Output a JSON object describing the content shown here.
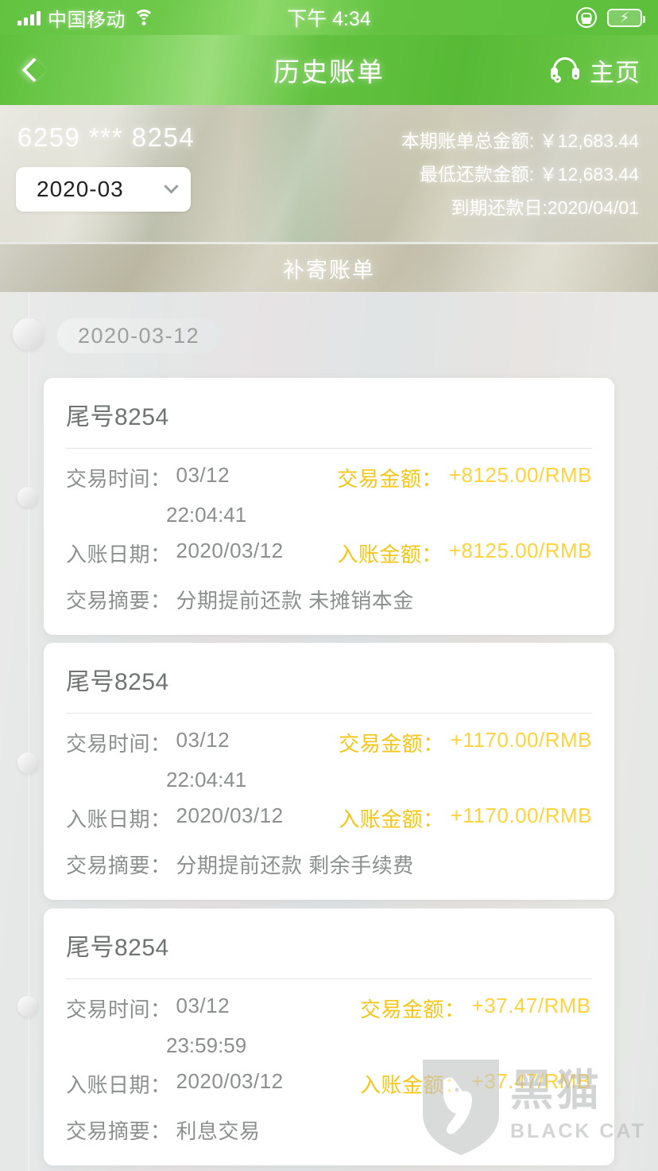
{
  "status_bar": {
    "carrier": "中国移动",
    "time": "下午 4:34",
    "signal_icon": "signal-bars-icon",
    "wifi_icon": "wifi-icon",
    "rotation_lock_icon": "rotation-lock-icon",
    "battery_icon": "battery-charging-icon"
  },
  "nav": {
    "back_icon": "chevron-left-icon",
    "title": "历史账单",
    "headset_icon": "headset-icon",
    "home_label": "主页"
  },
  "summary": {
    "card_number": "6259 *** 8254",
    "month_selected": "2020-03",
    "dropdown_icon": "chevron-down-icon",
    "total_amount_line": "本期账单总金额: ￥12,683.44",
    "min_payment_line": "最低还款金额: ￥12,683.44",
    "due_date_line": "到期还款日:2020/04/01"
  },
  "resend_bill": {
    "label": "补寄账单"
  },
  "list": {
    "date_group": "2020-03-12",
    "labels": {
      "trade_time": "交易时间：",
      "trade_amount": "交易金额：",
      "post_date": "入账日期：",
      "post_amount": "入账金额：",
      "summary": "交易摘要："
    },
    "transactions": [
      {
        "title": "尾号8254",
        "trade_date": "03/12",
        "trade_time": "22:04:41",
        "trade_amount": "+8125.00/RMB",
        "post_date": "2020/03/12",
        "post_amount": "+8125.00/RMB",
        "summary": "分期提前还款 未摊销本金"
      },
      {
        "title": "尾号8254",
        "trade_date": "03/12",
        "trade_time": "22:04:41",
        "trade_amount": "+1170.00/RMB",
        "post_date": "2020/03/12",
        "post_amount": "+1170.00/RMB",
        "summary": "分期提前还款 剩余手续费"
      },
      {
        "title": "尾号8254",
        "trade_date": "03/12",
        "trade_time": "23:59:59",
        "trade_amount": "+37.47/RMB",
        "post_date": "2020/03/12",
        "post_amount": "+37.47/RMB",
        "summary": "利息交易"
      }
    ]
  },
  "watermark": {
    "shield_icon": "black-cat-shield-icon",
    "cn_text": "黑猫",
    "en_text": "BLACK CAT"
  },
  "colors": {
    "brand_green": "#63c341",
    "amount_yellow": "#ffd23f",
    "label_gray": "#8b8f8e",
    "list_bg": "#e6e8e7"
  }
}
